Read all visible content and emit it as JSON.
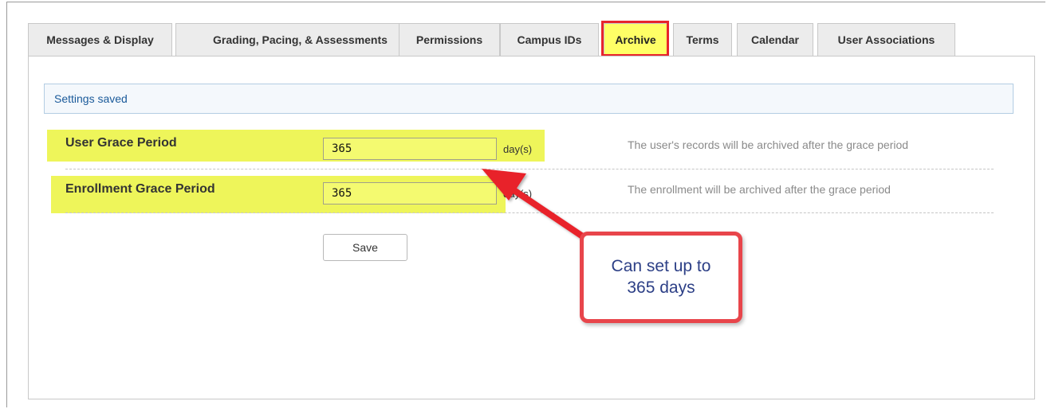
{
  "tabs": [
    {
      "label": "Messages & Display",
      "active": false
    },
    {
      "label": "Grading, Pacing, & Assessments",
      "active": false
    },
    {
      "label": "Permissions",
      "active": false
    },
    {
      "label": "Campus IDs",
      "active": false
    },
    {
      "label": "Archive",
      "active": true
    },
    {
      "label": "Terms",
      "active": false
    },
    {
      "label": "Calendar",
      "active": false
    },
    {
      "label": "User Associations",
      "active": false
    }
  ],
  "notice": {
    "text": "Settings saved"
  },
  "settings": {
    "user_grace": {
      "label": "User Grace Period",
      "value": "365",
      "unit": "day(s)",
      "description": "The user's records will be archived after the grace period"
    },
    "enrollment_grace": {
      "label": "Enrollment Grace Period",
      "value": "365",
      "unit": "day(s)",
      "description": "The enrollment will be archived after the grace period"
    }
  },
  "save_label": "Save",
  "callout": {
    "text": "Can set up to\n365 days"
  },
  "colors": {
    "highlight": "#eef55a",
    "active_tab": "#ffff66",
    "annotation_red": "#e8242c",
    "callout_text": "#2c3f86"
  }
}
